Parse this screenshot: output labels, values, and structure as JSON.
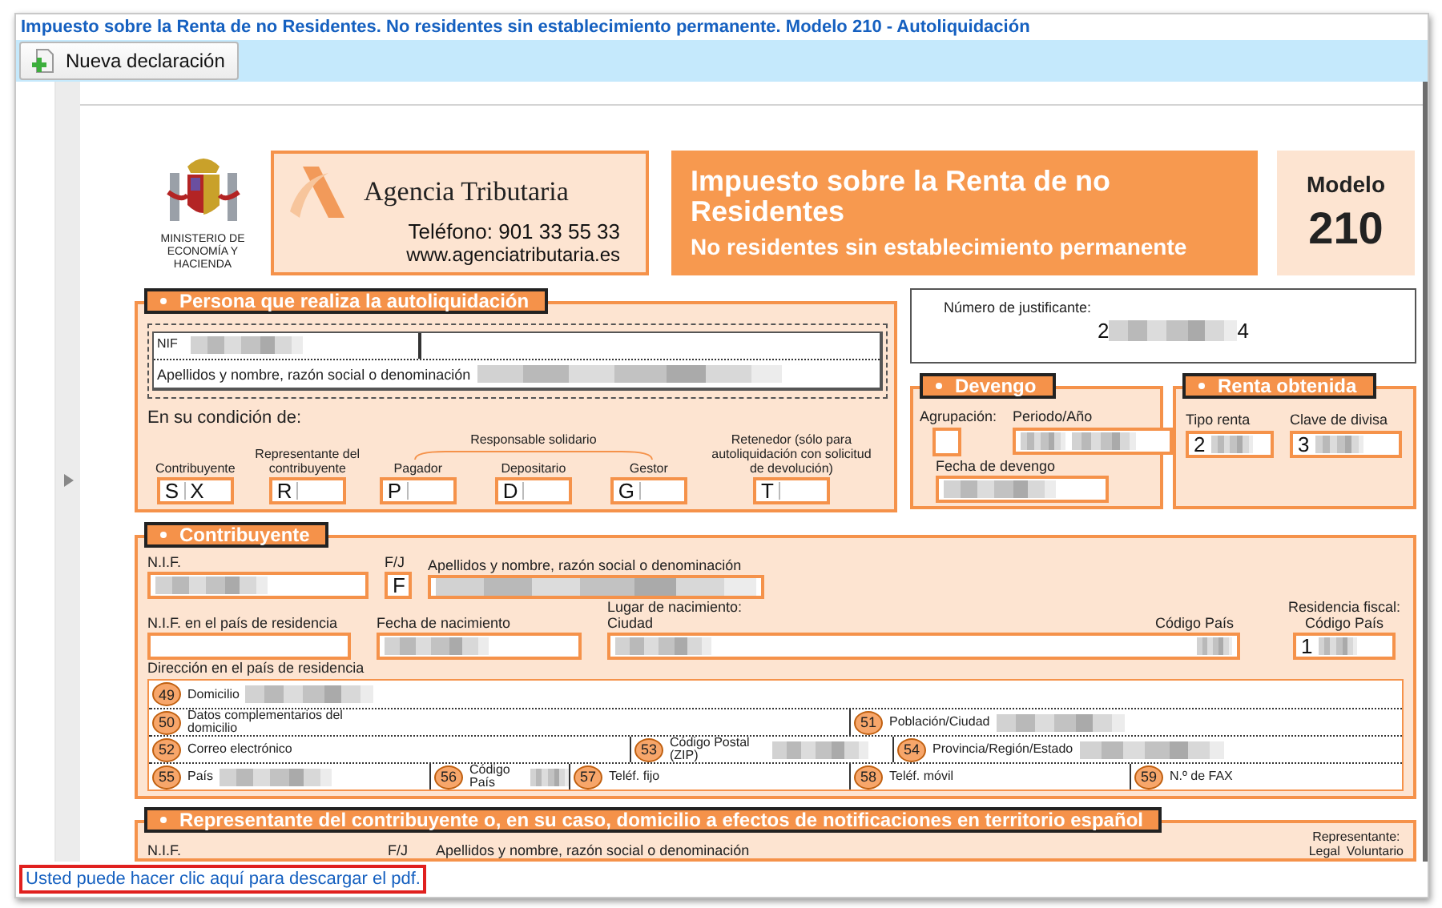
{
  "window": {
    "title": "Impuesto sobre la Renta de no Residentes. No residentes sin establecimiento permanente. Modelo 210 - Autoliquidación"
  },
  "toolbar": {
    "buttons": [
      {
        "label": "Nueva declaración"
      }
    ]
  },
  "header": {
    "ministry": "MINISTERIO DE ECONOMÍA Y HACIENDA",
    "agency": "Agencia Tributaria",
    "phone": "Teléfono: 901 33 55 33",
    "web": "www.agenciatributaria.es",
    "title": "Impuesto sobre la Renta de no Residentes",
    "subtitle": "No residentes sin establecimiento permanente",
    "model_label": "Modelo",
    "model_number": "210"
  },
  "persona": {
    "title": "Persona que realiza la autoliquidación",
    "nif_label": "NIF",
    "name_label": "Apellidos y nombre, razón social o denominación",
    "condition_label": "En su condición de:",
    "roles": [
      {
        "kind": "role",
        "label": "Contribuyente",
        "code": "S",
        "mark": "X"
      },
      {
        "kind": "role",
        "label": "Representante del contribuyente",
        "code": "R"
      },
      {
        "kind": "group",
        "label": "Responsable solidario",
        "roles": [
          {
            "label": "Pagador",
            "code": "P"
          },
          {
            "label": "Depositario",
            "code": "D"
          },
          {
            "label": "Gestor",
            "code": "G"
          }
        ]
      },
      {
        "kind": "role",
        "label": "Retenedor (sólo para autoliquidación con solicitud de devolución)",
        "code": "T"
      }
    ]
  },
  "justificante": {
    "label": "Número de justificante:",
    "value_start": "2",
    "value_end": "4"
  },
  "devengo": {
    "title": "Devengo",
    "agrupacion_label": "Agrupación:",
    "periodo_label": "Periodo/Año",
    "fecha_label": "Fecha de devengo"
  },
  "renta": {
    "title": "Renta obtenida",
    "tipo_label": "Tipo renta",
    "tipo_code": "2",
    "divisa_label": "Clave de divisa",
    "divisa_code": "3"
  },
  "contribuyente": {
    "title": "Contribuyente",
    "nif_label": "N.I.F.",
    "fj_label": "F/J",
    "fj_value": "F",
    "name_label": "Apellidos y nombre, razón social o denominación",
    "nif_res_label": "N.I.F. en el país de residencia",
    "birth_label": "Fecha de nacimiento",
    "birthplace_label": "Lugar de nacimiento:",
    "city_label": "Ciudad",
    "country_label": "Código País",
    "residence_label": "Residencia fiscal:",
    "residence_country_label": "Código País",
    "residence_code": "1",
    "address_label": "Dirección en el país de residencia",
    "address_rows": [
      [
        {
          "number": "49",
          "label": "Domicilio",
          "blurred": true
        }
      ],
      [
        {
          "number": "50",
          "label": "Datos complementarios del domicilio",
          "blurred": false
        },
        {
          "number": "51",
          "label": "Población/Ciudad",
          "blurred": true
        }
      ],
      [
        {
          "number": "52",
          "label": "Correo electrónico",
          "blurred": false
        },
        {
          "number": "53",
          "label": "Código Postal (ZIP)",
          "blurred": true
        },
        {
          "number": "54",
          "label": "Provincia/Región/Estado",
          "blurred": true
        }
      ],
      [
        {
          "number": "55",
          "label": "País",
          "blurred": true
        },
        {
          "number": "56",
          "label": "Código País",
          "blurred": true
        },
        {
          "number": "57",
          "label": "Teléf. fijo",
          "blurred": false
        },
        {
          "number": "58",
          "label": "Teléf. móvil",
          "blurred": false
        },
        {
          "number": "59",
          "label": "N.º de FAX",
          "blurred": false
        }
      ]
    ]
  },
  "representante": {
    "title": "Representante del contribuyente o, en su caso, domicilio a efectos de notificaciones en territorio español",
    "nif_label": "N.I.F.",
    "fj_label": "F/J",
    "name_label": "Apellidos y nombre, razón social o denominación",
    "rep_label": "Representante:",
    "legal_label": "Legal",
    "voluntario_label": "Voluntario"
  },
  "footer": {
    "link": "Usted puede hacer clic aquí para descargar el pdf."
  }
}
